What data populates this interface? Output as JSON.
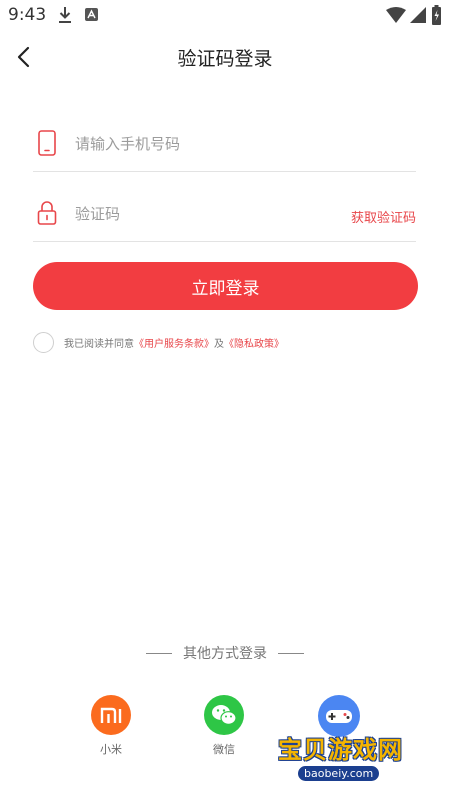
{
  "status_bar": {
    "time": "9:43"
  },
  "header": {
    "title": "验证码登录"
  },
  "form": {
    "phone_placeholder": "请输入手机号码",
    "code_placeholder": "验证码",
    "get_code_label": "获取验证码",
    "login_label": "立即登录"
  },
  "agreement": {
    "prefix": "我已阅读并同意",
    "terms_link": "《用户服务条款》",
    "connector": "及",
    "privacy_link": "《隐私政策》"
  },
  "other_login": {
    "title": "其他方式登录",
    "items": [
      {
        "label": "小米",
        "icon": "xiaomi-logo-icon"
      },
      {
        "label": "微信",
        "icon": "wechat-logo-icon"
      }
    ]
  },
  "watermark": {
    "title": "宝贝游戏网",
    "url": "baobeiy.com"
  },
  "colors": {
    "accent": "#f23d41",
    "link": "#e8464a",
    "xiaomi": "#fb6b1e",
    "wechat": "#2ec646"
  }
}
